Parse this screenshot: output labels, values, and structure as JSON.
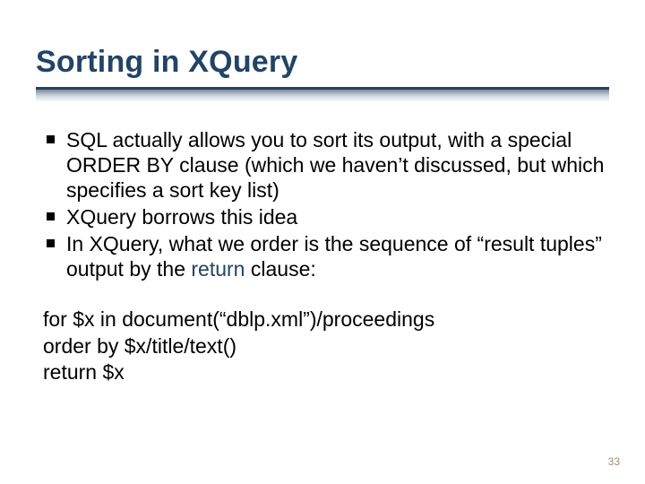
{
  "title": "Sorting in XQuery",
  "bullets": [
    "SQL actually allows you to sort its output, with a special ORDER BY clause (which we haven’t discussed, but which specifies a sort key list)",
    "XQuery borrows this idea",
    "In XQuery, what we order is the sequence of “result tuples” output by the "
  ],
  "bullet3_keyword": "return",
  "bullet3_suffix": " clause:",
  "code": {
    "line1": "for $x in document(“dblp.xml”)/proceedings",
    "line2": "order by $x/title/text()",
    "line3": "return $x"
  },
  "page_number": "33"
}
